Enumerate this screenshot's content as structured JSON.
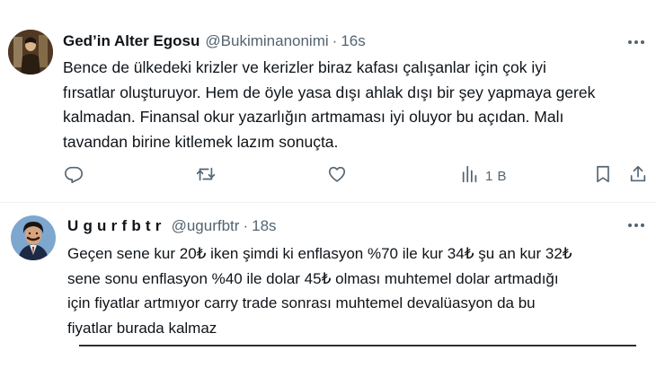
{
  "tweets": [
    {
      "display_name": "Ged’in Alter Egosu",
      "handle": "@Bukiminanonimi",
      "separator": "·",
      "time": "16s",
      "lines": [
        "Bence de ülkedeki krizler ve kerizler biraz kafası çalışanlar için çok iyi",
        "fırsatlar oluşturuyor. Hem de öyle yasa dışı ahlak dışı bir şey yapmaya gerek",
        "kalmadan. Finansal okur yazarlığın artmaması iyi oluyor bu açıdan. Malı",
        "tavandan birine kitlemek lazım sonuçta."
      ],
      "actions": {
        "reply_icon": "reply-icon",
        "retweet_icon": "retweet-icon",
        "like_icon": "heart-icon",
        "views_icon": "views-icon",
        "views_count": "1 B",
        "bookmark_icon": "bookmark-icon",
        "share_icon": "share-icon"
      }
    },
    {
      "display_name": "Ugurfbtr",
      "handle": "@ugurfbtr",
      "separator": "·",
      "time": "18s",
      "lines": [
        "Geçen sene kur 20₺ iken şimdi ki enflasyon %70 ile kur 34₺ şu an kur 32₺",
        "sene sonu enflasyon %40 ile dolar 45₺ olması muhtemel dolar artmadığı",
        "için fiyatlar artmıyor carry trade sonrası muhtemel devalüasyon da bu",
        "fiyatlar burada kalmaz"
      ]
    }
  ],
  "colors": {
    "text": "#0f1419",
    "secondary": "#536471",
    "border": "#eff3f4"
  }
}
